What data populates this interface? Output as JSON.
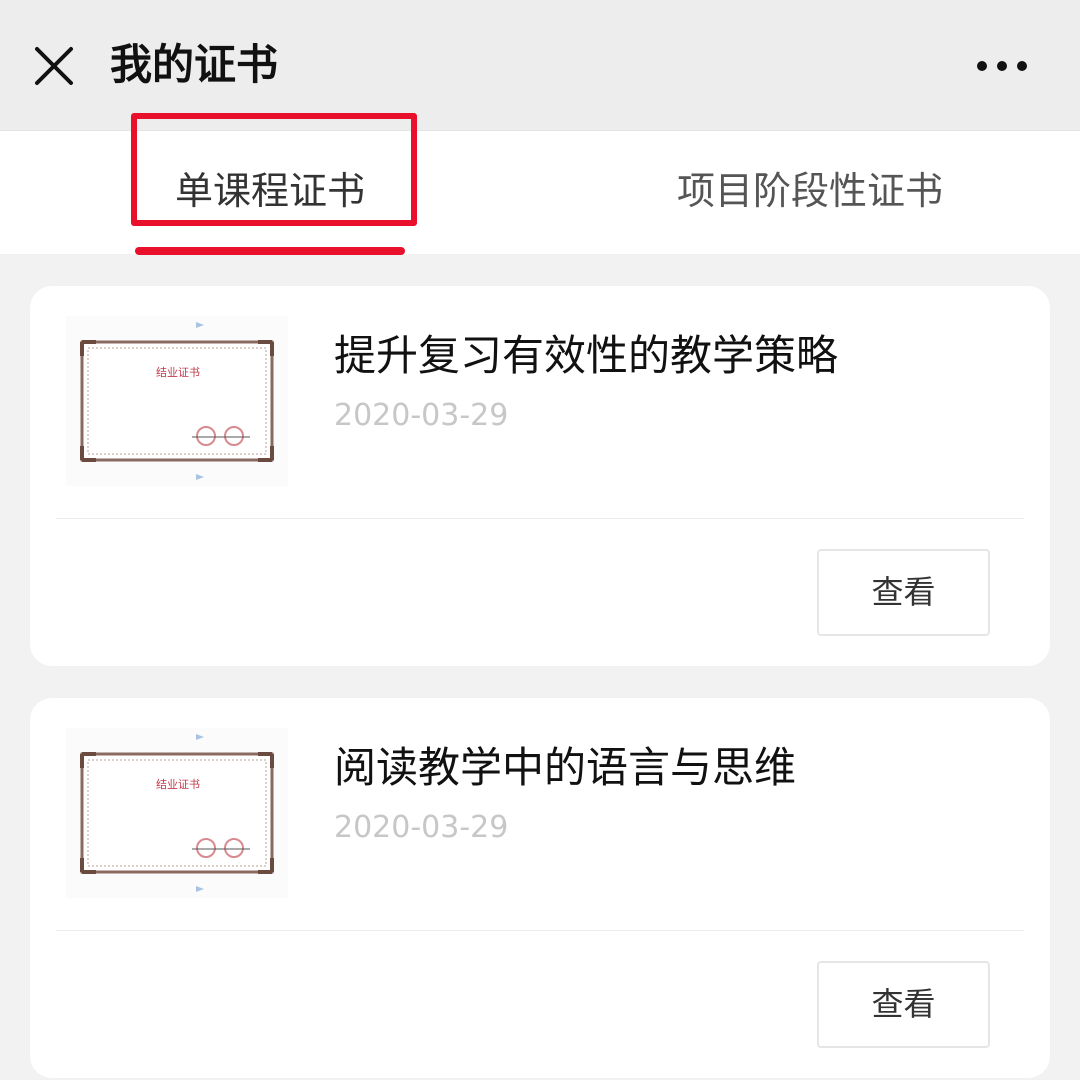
{
  "header": {
    "title": "我的证书",
    "close_icon": "close-icon",
    "more_icon": "more-horizontal-icon"
  },
  "tabs": [
    {
      "label": "单课程证书",
      "active": true
    },
    {
      "label": "项目阶段性证书",
      "active": false
    }
  ],
  "colors": {
    "accent": "#e8102a",
    "header_bg": "#ededed",
    "page_bg": "#f2f2f2",
    "date_text": "#c7c7c7"
  },
  "certificates": [
    {
      "title": "提升复习有效性的教学策略",
      "date": "2020-03-29",
      "thumbnail_text": "结业证书",
      "action_label": "查看"
    },
    {
      "title": "阅读教学中的语言与思维",
      "date": "2020-03-29",
      "thumbnail_text": "结业证书",
      "action_label": "查看"
    }
  ]
}
